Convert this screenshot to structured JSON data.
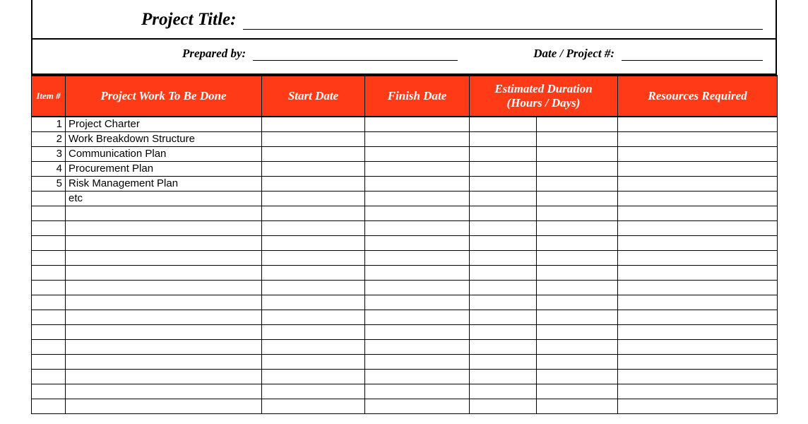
{
  "header": {
    "project_title_label": "Project Title:",
    "project_title_value": "",
    "prepared_by_label": "Prepared by:",
    "prepared_by_value": "",
    "date_project_label": "Date / Project #:",
    "date_project_value": ""
  },
  "columns": {
    "item": "Item #",
    "work": "Project Work To Be Done",
    "start": "Start Date",
    "finish": "Finish Date",
    "duration_line1": "Estimated Duration",
    "duration_line2": "(Hours  /  Days)",
    "resources": "Resources Required"
  },
  "rows": [
    {
      "num": "1",
      "work": "Project Charter",
      "start": "",
      "finish": "",
      "dur_a": "",
      "dur_b": "",
      "res": ""
    },
    {
      "num": "2",
      "work": "Work Breakdown Structure",
      "start": "",
      "finish": "",
      "dur_a": "",
      "dur_b": "",
      "res": ""
    },
    {
      "num": "3",
      "work": "Communication Plan",
      "start": "",
      "finish": "",
      "dur_a": "",
      "dur_b": "",
      "res": ""
    },
    {
      "num": "4",
      "work": "Procurement Plan",
      "start": "",
      "finish": "",
      "dur_a": "",
      "dur_b": "",
      "res": ""
    },
    {
      "num": "5",
      "work": "Risk Management Plan",
      "start": "",
      "finish": "",
      "dur_a": "",
      "dur_b": "",
      "res": ""
    },
    {
      "num": "",
      "work": "etc",
      "start": "",
      "finish": "",
      "dur_a": "",
      "dur_b": "",
      "res": ""
    },
    {
      "num": "",
      "work": "",
      "start": "",
      "finish": "",
      "dur_a": "",
      "dur_b": "",
      "res": ""
    },
    {
      "num": "",
      "work": "",
      "start": "",
      "finish": "",
      "dur_a": "",
      "dur_b": "",
      "res": ""
    },
    {
      "num": "",
      "work": "",
      "start": "",
      "finish": "",
      "dur_a": "",
      "dur_b": "",
      "res": ""
    },
    {
      "num": "",
      "work": "",
      "start": "",
      "finish": "",
      "dur_a": "",
      "dur_b": "",
      "res": ""
    },
    {
      "num": "",
      "work": "",
      "start": "",
      "finish": "",
      "dur_a": "",
      "dur_b": "",
      "res": ""
    },
    {
      "num": "",
      "work": "",
      "start": "",
      "finish": "",
      "dur_a": "",
      "dur_b": "",
      "res": ""
    },
    {
      "num": "",
      "work": "",
      "start": "",
      "finish": "",
      "dur_a": "",
      "dur_b": "",
      "res": ""
    },
    {
      "num": "",
      "work": "",
      "start": "",
      "finish": "",
      "dur_a": "",
      "dur_b": "",
      "res": ""
    },
    {
      "num": "",
      "work": "",
      "start": "",
      "finish": "",
      "dur_a": "",
      "dur_b": "",
      "res": ""
    },
    {
      "num": "",
      "work": "",
      "start": "",
      "finish": "",
      "dur_a": "",
      "dur_b": "",
      "res": ""
    },
    {
      "num": "",
      "work": "",
      "start": "",
      "finish": "",
      "dur_a": "",
      "dur_b": "",
      "res": ""
    },
    {
      "num": "",
      "work": "",
      "start": "",
      "finish": "",
      "dur_a": "",
      "dur_b": "",
      "res": ""
    },
    {
      "num": "",
      "work": "",
      "start": "",
      "finish": "",
      "dur_a": "",
      "dur_b": "",
      "res": ""
    },
    {
      "num": "",
      "work": "",
      "start": "",
      "finish": "",
      "dur_a": "",
      "dur_b": "",
      "res": ""
    }
  ]
}
